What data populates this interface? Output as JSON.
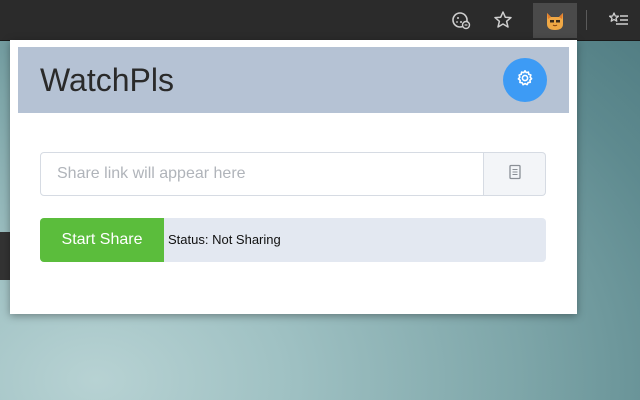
{
  "browser": {
    "icons": [
      "cookie-icon",
      "bookmark-star-icon",
      "extension-cat-icon",
      "reading-list-icon"
    ],
    "active_extension_bg": "#4a4a4a"
  },
  "popup": {
    "title": "WatchPls",
    "header_color": "#b5c2d4",
    "settings_button_color": "#3d9bf5",
    "share_link": {
      "value": "",
      "placeholder": "Share link will appear here"
    },
    "start_button_label": "Start Share",
    "start_button_color": "#5bbd3c",
    "status_text": "Status: Not Sharing"
  }
}
